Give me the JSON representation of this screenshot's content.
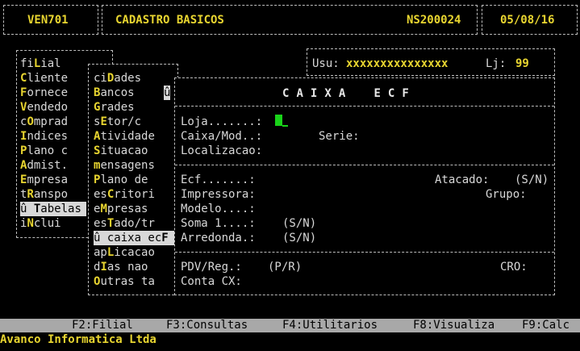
{
  "header": {
    "program_code": "VEN701",
    "screen_title": "CADASTRO BASICOS",
    "terminal_id": "NS200024",
    "date": "05/08/16"
  },
  "session": {
    "user_label": "Usu:",
    "user_value": "xxxxxxxxxxxxxxx",
    "store_label": "Lj:",
    "store_value": "99"
  },
  "main_menu": [
    {
      "pre": "fi",
      "key": "L",
      "post": "ial"
    },
    {
      "pre": "",
      "key": "C",
      "post": "liente"
    },
    {
      "pre": "",
      "key": "F",
      "post": "ornece"
    },
    {
      "pre": "",
      "key": "V",
      "post": "endedo"
    },
    {
      "pre": "c",
      "key": "O",
      "post": "mprad"
    },
    {
      "pre": "",
      "key": "I",
      "post": "ndices"
    },
    {
      "pre": "",
      "key": "P",
      "post": "lano c"
    },
    {
      "pre": "",
      "key": "A",
      "post": "dmist."
    },
    {
      "pre": "",
      "key": "E",
      "post": "mpresa"
    },
    {
      "pre": "t",
      "key": "R",
      "post": "anspo"
    },
    {
      "pre": "û ",
      "key": "T",
      "post": "abelas"
    },
    {
      "pre": "i",
      "key": "N",
      "post": "clui"
    }
  ],
  "main_menu_selected": 10,
  "sub_menu": [
    {
      "pre": "ci",
      "key": "D",
      "post": "ades"
    },
    {
      "pre": "",
      "key": "B",
      "post": "ancos"
    },
    {
      "pre": "",
      "key": "G",
      "post": "rades"
    },
    {
      "pre": "s",
      "key": "E",
      "post": "tor/c"
    },
    {
      "pre": "",
      "key": "A",
      "post": "tividade"
    },
    {
      "pre": "",
      "key": "S",
      "post": "ituacao"
    },
    {
      "pre": "",
      "key": "m",
      "post": "ensagens"
    },
    {
      "pre": "",
      "key": "P",
      "post": "lano de"
    },
    {
      "pre": "es",
      "key": "C",
      "post": "ritori"
    },
    {
      "pre": "e",
      "key": "M",
      "post": "presas"
    },
    {
      "pre": "es",
      "key": "T",
      "post": "ado/tr"
    },
    {
      "pre": "û caixa ec",
      "key": "F",
      "post": ""
    },
    {
      "pre": "ap",
      "key": "L",
      "post": "icacao"
    },
    {
      "pre": "d",
      "key": "I",
      "post": "as nao"
    },
    {
      "pre": "",
      "key": "O",
      "post": "utras ta"
    }
  ],
  "sub_menu_selected": 11,
  "submenu_side_glyph": "û",
  "form": {
    "title": "C A I X A    E C F",
    "loja": "Loja.......:",
    "caixa_mod": "Caixa/Mod..:",
    "serie": "Serie:",
    "localizacao": "Localizacao:",
    "ecf": "Ecf.......:",
    "atacado": "Atacado:",
    "atacado_opt": "(S/N)",
    "impressora": "Impressora:",
    "grupo": "Grupo:",
    "modelo": "Modelo....:",
    "soma": "Soma 1....:",
    "soma_opt": "(S/N)",
    "arredonda": "Arredonda.:",
    "arredonda_opt": "(S/N)",
    "pdv_reg": "PDV/Reg.:",
    "pdv_reg_opt": "(P/R)",
    "cro": "CRO:",
    "conta_cx": "Conta CX:"
  },
  "function_keys": [
    {
      "label": "F2:Filial"
    },
    {
      "label": "F3:Consultas"
    },
    {
      "label": "F4:Utilitarios"
    },
    {
      "label": "F8:Visualiza"
    },
    {
      "label": "F9:Calc"
    }
  ],
  "footer": {
    "company": "Avanco Informatica Ltda"
  },
  "colors": {
    "background": "#000000",
    "highlight": "#e8d530",
    "cursor": "#19d319",
    "function_bar": "#a8a8a8"
  }
}
